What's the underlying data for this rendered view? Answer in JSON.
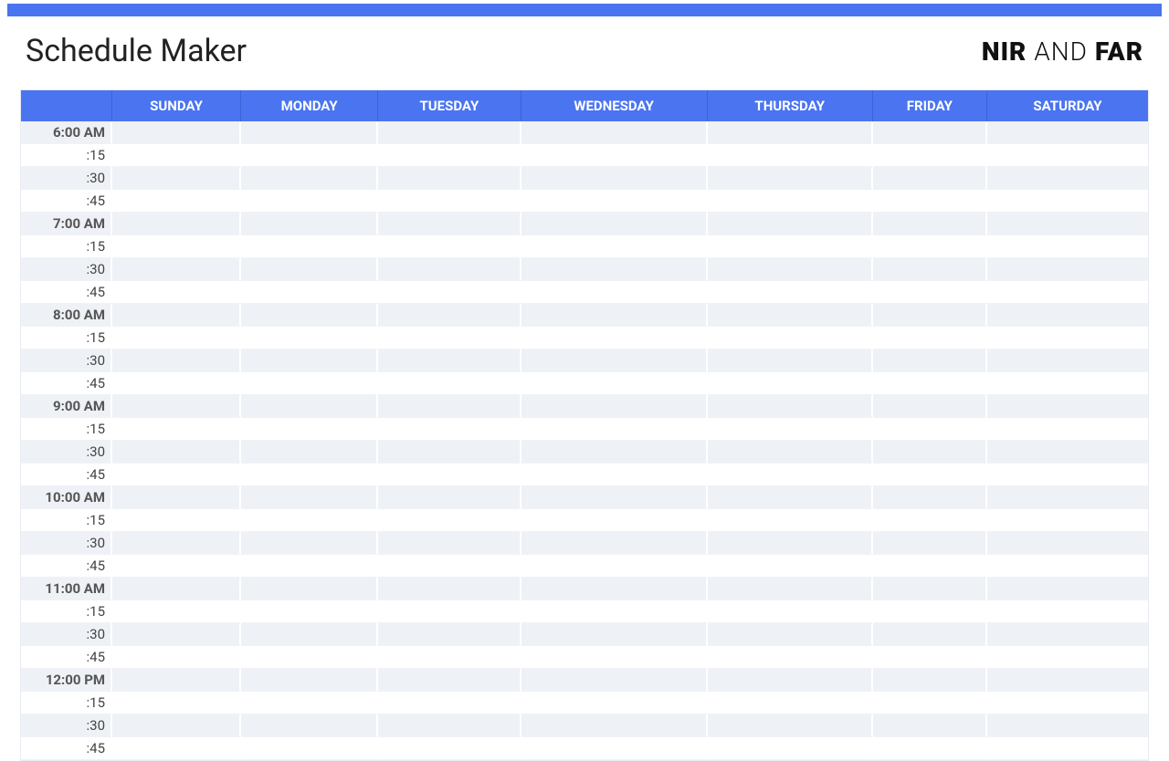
{
  "title": "Schedule Maker",
  "brand": {
    "w1": "NIR",
    "w2": "AND",
    "w3": "FAR"
  },
  "days": [
    "SUNDAY",
    "MONDAY",
    "TUESDAY",
    "WEDNESDAY",
    "THURSDAY",
    "FRIDAY",
    "SATURDAY"
  ],
  "rows": [
    {
      "label": "6:00 AM",
      "hour": true,
      "shade": true
    },
    {
      "label": ":15",
      "hour": false,
      "shade": false
    },
    {
      "label": ":30",
      "hour": false,
      "shade": true
    },
    {
      "label": ":45",
      "hour": false,
      "shade": false
    },
    {
      "label": "7:00 AM",
      "hour": true,
      "shade": true
    },
    {
      "label": ":15",
      "hour": false,
      "shade": false
    },
    {
      "label": ":30",
      "hour": false,
      "shade": true
    },
    {
      "label": ":45",
      "hour": false,
      "shade": false
    },
    {
      "label": "8:00 AM",
      "hour": true,
      "shade": true
    },
    {
      "label": ":15",
      "hour": false,
      "shade": false
    },
    {
      "label": ":30",
      "hour": false,
      "shade": true
    },
    {
      "label": ":45",
      "hour": false,
      "shade": false
    },
    {
      "label": "9:00 AM",
      "hour": true,
      "shade": true
    },
    {
      "label": ":15",
      "hour": false,
      "shade": false
    },
    {
      "label": ":30",
      "hour": false,
      "shade": true
    },
    {
      "label": ":45",
      "hour": false,
      "shade": false
    },
    {
      "label": "10:00 AM",
      "hour": true,
      "shade": true
    },
    {
      "label": ":15",
      "hour": false,
      "shade": false
    },
    {
      "label": ":30",
      "hour": false,
      "shade": true
    },
    {
      "label": ":45",
      "hour": false,
      "shade": false
    },
    {
      "label": "11:00 AM",
      "hour": true,
      "shade": true
    },
    {
      "label": ":15",
      "hour": false,
      "shade": false
    },
    {
      "label": ":30",
      "hour": false,
      "shade": true
    },
    {
      "label": ":45",
      "hour": false,
      "shade": false
    },
    {
      "label": "12:00 PM",
      "hour": true,
      "shade": true
    },
    {
      "label": ":15",
      "hour": false,
      "shade": false
    },
    {
      "label": ":30",
      "hour": false,
      "shade": true
    },
    {
      "label": ":45",
      "hour": false,
      "shade": false
    }
  ]
}
